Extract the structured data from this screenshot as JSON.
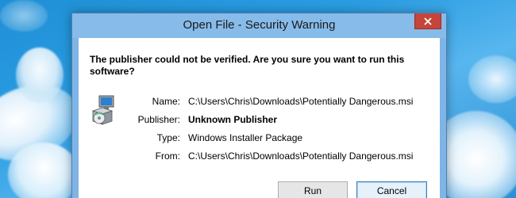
{
  "window": {
    "title": "Open File - Security Warning",
    "close_icon": "close-icon"
  },
  "dialog": {
    "question": "The publisher could not be verified.  Are you sure you want to run this software?",
    "icon": "installer-package-icon",
    "fields": [
      {
        "label": "Name:",
        "value": "C:\\Users\\Chris\\Downloads\\Potentially Dangerous.msi",
        "bold": false
      },
      {
        "label": "Publisher:",
        "value": "Unknown Publisher",
        "bold": true
      },
      {
        "label": "Type:",
        "value": "Windows Installer Package",
        "bold": false
      },
      {
        "label": "From:",
        "value": "C:\\Users\\Chris\\Downloads\\Potentially Dangerous.msi",
        "bold": false
      }
    ]
  },
  "buttons": {
    "run_label": "Run",
    "cancel_label": "Cancel"
  },
  "colors": {
    "titlebar": "#87bbea",
    "close_button": "#c7443a",
    "desktop": "#2a9de3"
  }
}
